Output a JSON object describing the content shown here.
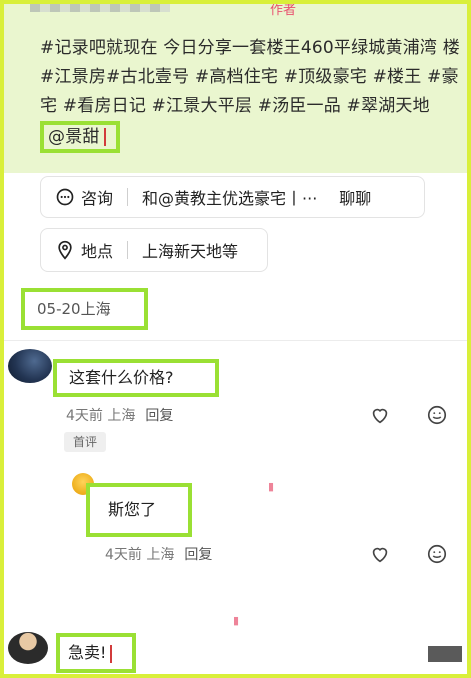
{
  "post": {
    "author_tag": "作者",
    "text_parts": [
      "#记录吧就现在 今日分享一套楼王460平绿城黄浦湾 楼#江景房#古北壹号 #高档住宅 #顶级豪宅 #楼王 #豪宅 #看房日记 #江景大平层 #汤臣一品 #翠湖天地 "
    ],
    "mention": "@景甜"
  },
  "consult": {
    "label": "咨询",
    "text": "和@黄教主优选豪宅丨···",
    "action": "聊聊"
  },
  "location": {
    "label": "地点",
    "value": "上海新天地等"
  },
  "post_date": "05-20上海",
  "comments": [
    {
      "text": "这套什么价格?",
      "time": "4天前 上海",
      "reply": "回复",
      "badge": "首评"
    },
    {
      "text": "斯您了",
      "time": "4天前 上海",
      "reply": "回复"
    },
    {
      "text": "急卖!"
    }
  ],
  "icons": {
    "chat": "chat-bubble-icon",
    "location": "location-pin-icon",
    "like": "heart-icon",
    "emoji": "emoji-icon"
  },
  "colors": {
    "highlight": "#9ae034",
    "frame": "#d9ef3a",
    "tint": "#eaf6cf",
    "author": "#e8516f"
  }
}
